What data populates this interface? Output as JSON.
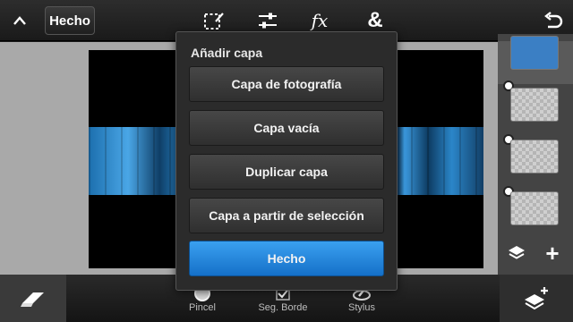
{
  "toolbar": {
    "done_label": "Hecho",
    "icons": [
      "chevron-up-icon",
      "selection-icon",
      "adjustments-icon",
      "fx-icon",
      "ampersand-icon",
      "undo-icon"
    ],
    "fx_label": "fx",
    "amp_label": "&"
  },
  "dialog": {
    "title": "Añadir capa",
    "buttons": [
      "Capa de fotografía",
      "Capa vacía",
      "Duplicar capa",
      "Capa a partir de selección"
    ],
    "done_label": "Hecho"
  },
  "layers_panel": {
    "add_label": "+",
    "layer_count": 4
  },
  "bottom_tools": [
    {
      "label": "Pincel",
      "icon": "brush-circle-icon"
    },
    {
      "label": "Seg. Borde",
      "icon": "edge-check-icon"
    },
    {
      "label": "Stylus",
      "icon": "stylus-icon"
    }
  ],
  "colors": {
    "accent": "#1e88e5",
    "toolbar_bg": "#222222",
    "dialog_bg": "#2b2b2b"
  }
}
